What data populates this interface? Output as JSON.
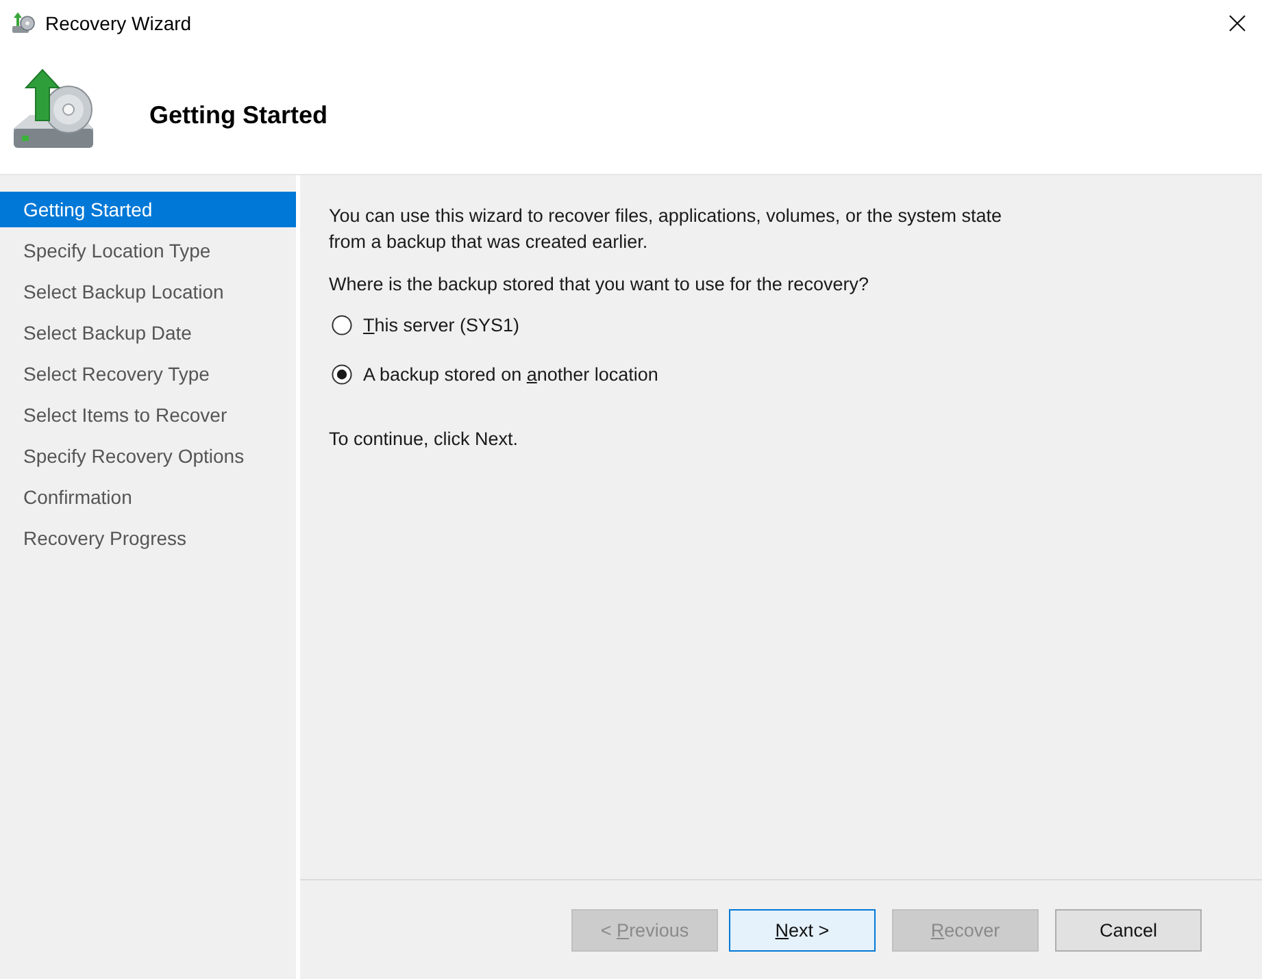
{
  "window": {
    "title": "Recovery Wizard"
  },
  "header": {
    "title": "Getting Started"
  },
  "steps": [
    {
      "label": "Getting Started",
      "selected": true
    },
    {
      "label": "Specify Location Type",
      "selected": false
    },
    {
      "label": "Select Backup Location",
      "selected": false
    },
    {
      "label": "Select Backup Date",
      "selected": false
    },
    {
      "label": "Select Recovery Type",
      "selected": false
    },
    {
      "label": "Select Items to Recover",
      "selected": false
    },
    {
      "label": "Specify Recovery Options",
      "selected": false
    },
    {
      "label": "Confirmation",
      "selected": false
    },
    {
      "label": "Recovery Progress",
      "selected": false
    }
  ],
  "content": {
    "intro": "You can use this wizard to recover files, applications, volumes, or the system state from a backup that was created earlier.",
    "question": "Where is the backup stored that you want to use for the recovery?",
    "options": [
      {
        "label_parts": [
          {
            "text": "T",
            "underlined": true
          },
          {
            "text": "his server (SYS1)",
            "underlined": false
          }
        ],
        "selected": false
      },
      {
        "label_parts": [
          {
            "text": "A backup stored on ",
            "underlined": false
          },
          {
            "text": "a",
            "underlined": true
          },
          {
            "text": "nother location",
            "underlined": false
          }
        ],
        "selected": true
      }
    ],
    "hint": "To continue, click Next."
  },
  "buttons": [
    {
      "label_parts": [
        {
          "text": "< ",
          "underlined": false
        },
        {
          "text": "P",
          "underlined": true
        },
        {
          "text": "revious",
          "underlined": false
        }
      ],
      "disabled": true,
      "default": false
    },
    {
      "label_parts": [
        {
          "text": "N",
          "underlined": true
        },
        {
          "text": "ext >",
          "underlined": false
        }
      ],
      "disabled": false,
      "default": true
    },
    {
      "label_parts": [
        {
          "text": "R",
          "underlined": true
        },
        {
          "text": "ecover",
          "underlined": false
        }
      ],
      "disabled": true,
      "default": false
    },
    {
      "label_parts": [
        {
          "text": "Cancel",
          "underlined": false
        }
      ],
      "disabled": false,
      "default": false
    }
  ]
}
